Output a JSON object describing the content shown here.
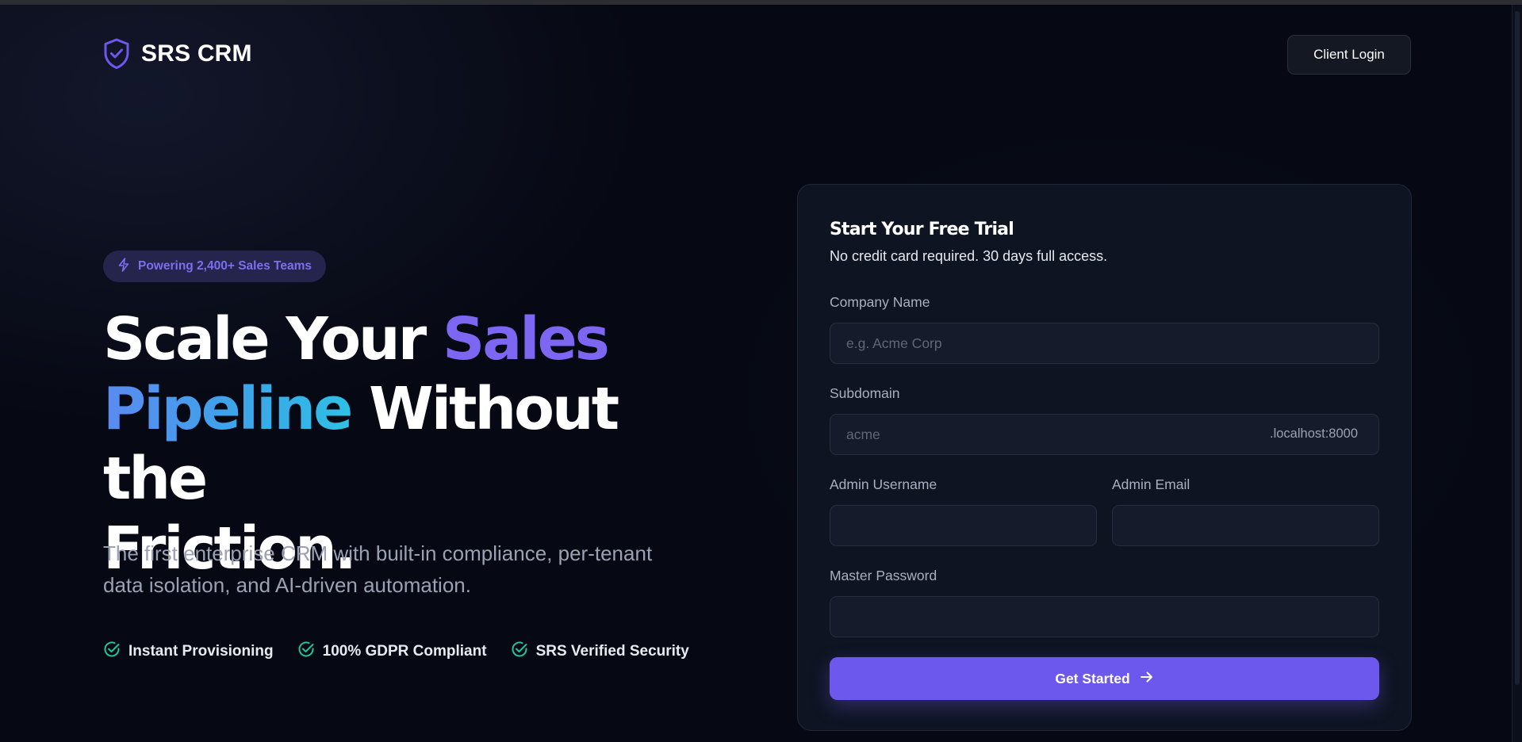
{
  "header": {
    "brand_name": "SRS CRM",
    "client_login_label": "Client Login"
  },
  "hero": {
    "badge": "Powering 2,400+ Sales Teams",
    "headline": {
      "part1": "Scale Your ",
      "part2": "Sales",
      "part3": "Pipeline",
      "part4": " Without the",
      "part5": "Friction."
    },
    "subtext": "The first enterprise CRM with built-in compliance, per-tenant data isolation, and AI-driven automation.",
    "features": [
      {
        "label": "Instant Provisioning",
        "icon": "check-circle-icon"
      },
      {
        "label": "100% GDPR Compliant",
        "icon": "check-circle-icon"
      },
      {
        "label": "SRS Verified Security",
        "icon": "check-circle-icon"
      }
    ]
  },
  "signup": {
    "title": "Start Your Free Trial",
    "subtitle": "No credit card required. 30 days full access.",
    "company": {
      "label": "Company Name",
      "placeholder": "e.g. Acme Corp",
      "value": ""
    },
    "subdomain": {
      "label": "Subdomain",
      "placeholder": "acme",
      "suffix": ".localhost:8000",
      "value": ""
    },
    "admin_username": {
      "label": "Admin Username",
      "value": ""
    },
    "admin_email": {
      "label": "Admin Email",
      "value": ""
    },
    "master_password": {
      "label": "Master Password",
      "value": ""
    },
    "submit_label": "Get Started"
  },
  "colors": {
    "accent": "#6c58ec",
    "accent_text": "#7c66f2",
    "gradient_blue": "#3aa7e8",
    "check_green": "#22c59a",
    "background": "#060913",
    "card": "#0f1422"
  },
  "icons": {
    "brand": "shield-check-icon",
    "badge": "lightning-icon",
    "submit": "arrow-right-icon"
  }
}
